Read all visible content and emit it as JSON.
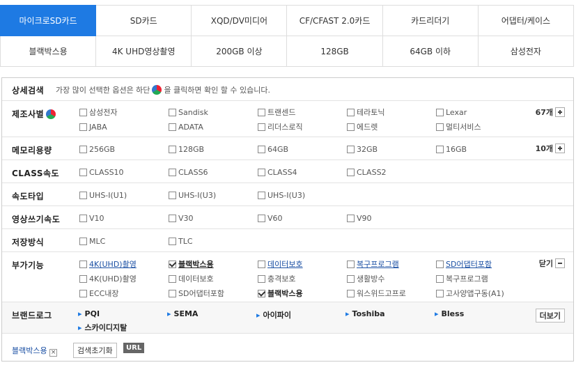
{
  "categories_row1": [
    "마이크로SD카드",
    "SD카드",
    "XQD/DV미디어",
    "CF/CFAST 2.0카드",
    "카드리더기",
    "어댑터/케이스"
  ],
  "categories_row2": [
    "블랙박스용",
    "4K UHD영상촬영",
    "200GB 이상",
    "128GB",
    "64GB 이하",
    "삼성전자"
  ],
  "header": {
    "title": "상세검색",
    "desc_before": "가장 많이 선택한 옵션은 하단",
    "desc_after": "을 클릭하면 확인 할 수 있습니다."
  },
  "maker": {
    "label": "제조사별",
    "count": "67개",
    "options": [
      "삼성전자",
      "Sandisk",
      "트랜센드",
      "테라토닉",
      "Lexar",
      "JABA",
      "ADATA",
      "리더스로직",
      "에드렛",
      "멀티서비스"
    ]
  },
  "memory": {
    "label": "메모리용량",
    "count": "10개",
    "options": [
      "256GB",
      "128GB",
      "64GB",
      "32GB",
      "16GB"
    ]
  },
  "class": {
    "label": "CLASS속도",
    "options": [
      "CLASS10",
      "CLASS6",
      "CLASS4",
      "CLASS2"
    ]
  },
  "speed": {
    "label": "속도타입",
    "options": [
      "UHS-I(U1)",
      "UHS-I(U3)",
      "UHS-I(U3)"
    ]
  },
  "video": {
    "label": "영상쓰기속도",
    "options": [
      "V10",
      "V30",
      "V60",
      "V90"
    ]
  },
  "storage": {
    "label": "저장방식",
    "options": [
      "MLC",
      "TLC"
    ]
  },
  "extra": {
    "label": "부가기능",
    "close_label": "닫기",
    "options": [
      "4K(UHD)촬영",
      "블랙박스용",
      "데이터보호",
      "복구프로그램",
      "SD어댑터포함",
      "4K(UHD)촬영",
      "데이터보호",
      "복구프로그램",
      "ECC내장",
      "SD어댑터포함",
      "블랙박스용",
      "충격보호",
      "생활방수",
      "고사양앱구동(A1)"
    ],
    "row1": [
      "4K(UHD)촬영",
      "블랙박스용",
      "데이터보호",
      "복구프로그램",
      "SD어댑터포함"
    ],
    "row2": [
      "4K(UHD)촬영",
      "데이터보호",
      "충격보호",
      "생활방수",
      "복구프로그램"
    ],
    "row3": [
      "ECC내장",
      "SD어댑터포함",
      "블랙박스용",
      "워스위드고프로",
      "고사양앱구동(A1)"
    ]
  },
  "brandlogo": {
    "label": "브랜드로그",
    "more": "더보기",
    "brands": [
      "PQI",
      "SEMA",
      "아이파이",
      "Toshiba",
      "Bless",
      "스카이디지탈"
    ]
  },
  "selected": {
    "tag": "블랙박스용",
    "reset": "검색초기화",
    "url": "URL"
  }
}
